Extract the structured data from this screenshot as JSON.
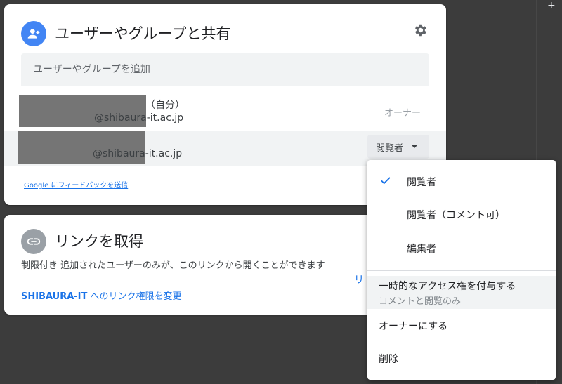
{
  "share": {
    "title": "ユーザーやグループと共有",
    "add_placeholder": "ユーザーやグループを追加",
    "people": [
      {
        "self_tag": "（自分）",
        "email": "@shibaura-it.ac.jp",
        "role": "オーナー"
      },
      {
        "email": "@shibaura-it.ac.jp",
        "role": "閲覧者"
      }
    ],
    "feedback": "Google にフィードバックを送信"
  },
  "link": {
    "title": "リンクを取得",
    "description": "制限付き 追加されたユーザーのみが、このリンクから開くことができます",
    "change_org": "SHIBAURA-IT",
    "change_rest": " へのリンク権限を変更",
    "copy_partial": "リ"
  },
  "menu": {
    "items": [
      {
        "label": "閲覧者",
        "checked": true
      },
      {
        "label": "閲覧者（コメント可）",
        "checked": false
      },
      {
        "label": "編集者",
        "checked": false
      }
    ],
    "temp_access": {
      "label": "一時的なアクセス権を付与する",
      "sub": "コメントと閲覧のみ"
    },
    "make_owner": "オーナーにする",
    "remove": "削除"
  },
  "colors": {
    "accent": "#1a73e8",
    "avatar_blue": "#4285f4",
    "link_grey": "#9aa0a6"
  },
  "icons": {
    "header": "person-add-icon",
    "settings": "gear-icon",
    "link": "link-icon",
    "check": "check-icon",
    "dropdown": "caret-down-icon"
  }
}
